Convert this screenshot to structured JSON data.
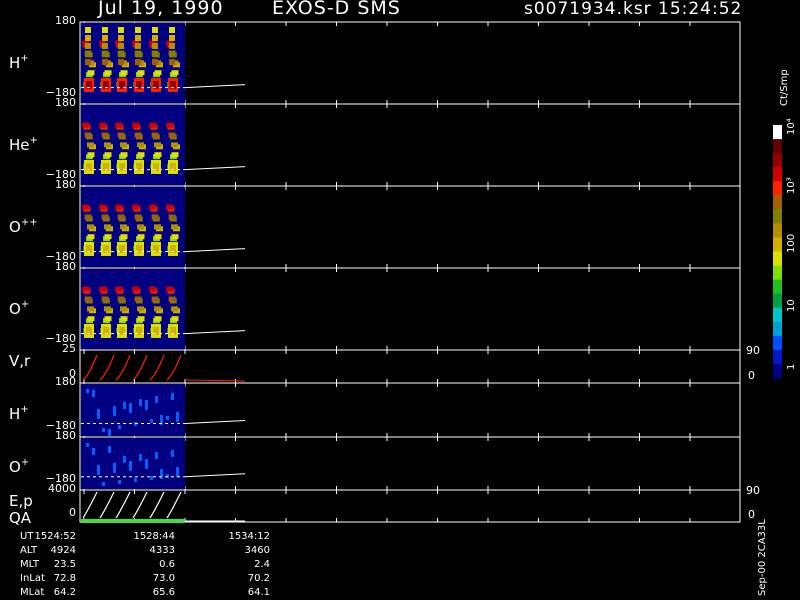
{
  "header": {
    "date": "Jul 19, 1990",
    "mission": "EXOS-D SMS",
    "file": "s0071934.ksr",
    "time": "15:24:52"
  },
  "colorbar": {
    "unit": "Ct/Smp",
    "ticks": [
      "1",
      "10",
      "100",
      "10³",
      "10⁴"
    ],
    "colors": [
      "#000080",
      "#0018c0",
      "#0050ff",
      "#00a0d0",
      "#00c8c8",
      "#00a040",
      "#20c020",
      "#80e000",
      "#e0e000",
      "#d0b000",
      "#b09000",
      "#808000",
      "#a06000",
      "#ff2000",
      "#d00000",
      "#900000",
      "#600000",
      "#ffffff"
    ]
  },
  "panels": [
    {
      "id": "hplus",
      "species": "H",
      "charge": "+",
      "top_tick": "180",
      "bottom_tick": "−180",
      "kind": "pitch"
    },
    {
      "id": "heplus",
      "species": "He",
      "charge": "+",
      "top_tick": "180",
      "bottom_tick": "−180",
      "kind": "pitch"
    },
    {
      "id": "oplusplus",
      "species": "O",
      "charge": "++",
      "top_tick": "180",
      "bottom_tick": "−180",
      "kind": "pitch"
    },
    {
      "id": "oplus",
      "species": "O",
      "charge": "+",
      "top_tick": "180",
      "bottom_tick": "−180",
      "kind": "pitch"
    },
    {
      "id": "vr",
      "species": "V,r",
      "charge": "",
      "top_tick": "25",
      "bottom_tick": "0",
      "right_top": "90",
      "right_bottom": "0",
      "kind": "line"
    },
    {
      "id": "hplus2",
      "species": "H",
      "charge": "+",
      "top_tick": "180",
      "bottom_tick": "−180",
      "kind": "pitch2"
    },
    {
      "id": "oplus2",
      "species": "O",
      "charge": "+",
      "top_tick": "180",
      "bottom_tick": "−180",
      "kind": "pitch2"
    },
    {
      "id": "ep",
      "species": "E,p",
      "charge": "",
      "top_tick": "4000",
      "bottom_tick": "0",
      "right_top": "90",
      "right_bottom": "0",
      "kind": "line2"
    }
  ],
  "qa_label": "QA",
  "footer_right": "Sep-00 2CA33L",
  "ephemeris": {
    "labels": [
      "UT",
      "ALT",
      "MLT",
      "InLat",
      "MLat"
    ],
    "columns": [
      [
        "1524:52",
        "4924",
        "23.5",
        "72.8",
        "64.2"
      ],
      [
        "1528:44",
        "4333",
        "0.6",
        "73.0",
        "65.6"
      ],
      [
        "1534:12",
        "3460",
        "2.4",
        "70.2",
        "64.1"
      ]
    ]
  },
  "chart_data": {
    "type": "heatmap",
    "title": "Jul 19, 1990   EXOS-D SMS",
    "x": [
      "1524:52",
      "1528:44",
      "1534:12"
    ],
    "xlabel": "UT",
    "ylabel": "",
    "pitch_angle_range": [
      -180,
      180
    ],
    "vr_range": [
      0,
      25
    ],
    "ep_range": [
      0,
      4000
    ],
    "colorscale": "log",
    "colorscale_range": [
      1,
      10000
    ],
    "data_coverage_end_ut": "1528:44",
    "series": [
      {
        "name": "H+",
        "sweeps": 6
      },
      {
        "name": "He+",
        "sweeps": 6
      },
      {
        "name": "O++",
        "sweeps": 6
      },
      {
        "name": "O+",
        "sweeps": 6
      },
      {
        "name": "V,r",
        "sweeps": 6
      },
      {
        "name": "H+",
        "sweeps": 6
      },
      {
        "name": "O+",
        "sweeps": 6
      },
      {
        "name": "E,p",
        "sweeps": 6
      }
    ]
  }
}
